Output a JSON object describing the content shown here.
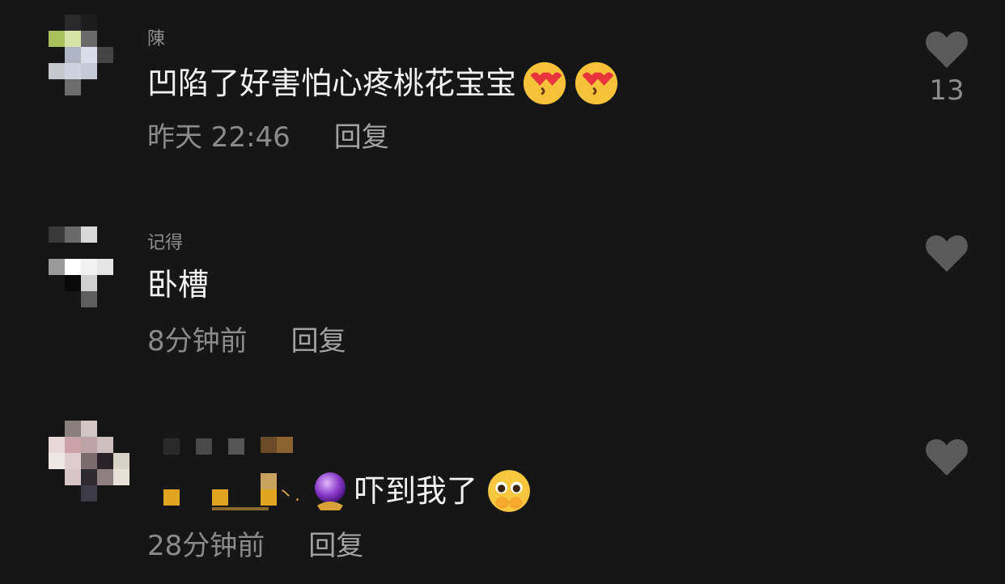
{
  "comments": [
    {
      "username": "陳",
      "text": "凹陷了好害怕心疼桃花宝宝",
      "time": "昨天 22:46",
      "reply_label": "回复",
      "likes": "13",
      "emojis": [
        "heart-eyes-kiss-emoji",
        "heart-eyes-kiss-emoji"
      ]
    },
    {
      "username": "记得",
      "text": "卧槽",
      "time": "8分钟前",
      "reply_label": "回复",
      "likes": ""
    },
    {
      "username": "",
      "username_suffix": "丶.",
      "text": "吓到我了",
      "time": "28分钟前",
      "reply_label": "回复",
      "likes": "",
      "emojis": [
        "crystal-ball-emoji",
        "pleading-face-emoji"
      ]
    }
  ],
  "colors": {
    "background": "#161616",
    "text": "#f2f2f2",
    "secondary": "#8b8b8b",
    "like_icon": "#5a5a5a"
  }
}
